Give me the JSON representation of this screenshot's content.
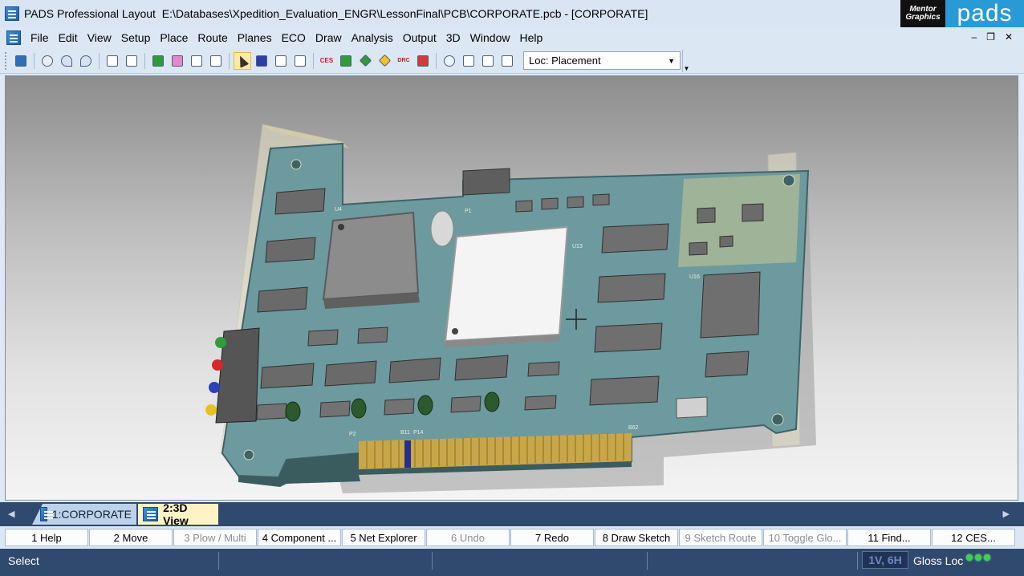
{
  "window": {
    "app_name": "PADS Professional Layout",
    "file_path": "E:\\Databases\\Xpedition_Evaluation_ENGR\\LessonFinal\\PCB\\CORPORATE.pcb - [CORPORATE]",
    "brand_mentor": "Mentor Graphics",
    "brand_pads": "pads"
  },
  "menu": [
    "File",
    "Edit",
    "View",
    "Setup",
    "Place",
    "Route",
    "Planes",
    "ECO",
    "Draw",
    "Analysis",
    "Output",
    "3D",
    "Window",
    "Help"
  ],
  "toolbar": {
    "location_select": "Loc: Placement",
    "ces_label": "CES",
    "drc_label": "DRC"
  },
  "tabs": [
    {
      "label": "1:CORPORATE"
    },
    {
      "label": "2:3D View"
    }
  ],
  "function_keys": [
    {
      "label": "1 Help",
      "enabled": true
    },
    {
      "label": "2 Move",
      "enabled": true
    },
    {
      "label": "3 Plow / Multi",
      "enabled": false
    },
    {
      "label": "4 Component ...",
      "enabled": true
    },
    {
      "label": "5 Net Explorer",
      "enabled": true
    },
    {
      "label": "6 Undo",
      "enabled": false
    },
    {
      "label": "7 Redo",
      "enabled": true
    },
    {
      "label": "8 Draw Sketch",
      "enabled": true
    },
    {
      "label": "9 Sketch Route",
      "enabled": false
    },
    {
      "label": "10 Toggle Glo...",
      "enabled": false
    },
    {
      "label": "11 Find...",
      "enabled": true
    },
    {
      "label": "12 CES...",
      "enabled": true
    }
  ],
  "status": {
    "mode": "Select",
    "layer": "1V, 6H",
    "gloss": "Gloss Loc"
  },
  "board_labels": {
    "u4": "U4",
    "u13": "U13",
    "u16": "U16",
    "p1": "P1",
    "p2": "P2",
    "b11": "B11",
    "b62": "B62",
    "p14": "P14"
  }
}
